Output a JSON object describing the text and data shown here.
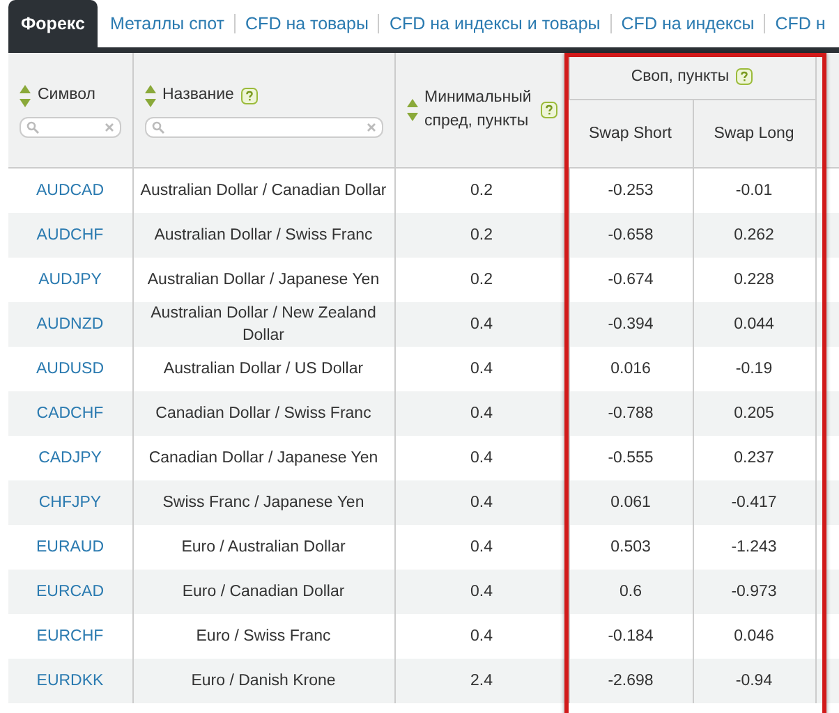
{
  "tabs": [
    {
      "label": "Форекс",
      "selected": true
    },
    {
      "label": "Металлы спот",
      "selected": false
    },
    {
      "label": "CFD на товары",
      "selected": false
    },
    {
      "label": "CFD на индексы и товары",
      "selected": false
    },
    {
      "label": "CFD на индексы",
      "selected": false
    },
    {
      "label": "CFD н",
      "selected": false
    }
  ],
  "table": {
    "columns": [
      {
        "label": "Символ",
        "sortable": true,
        "help": false,
        "search": true
      },
      {
        "label": "Название",
        "sortable": true,
        "help": true,
        "search": true
      },
      {
        "label": "Минимальный спред, пункты",
        "sortable": true,
        "help": true,
        "search": false
      }
    ],
    "swap_group": {
      "label": "Своп, пункты",
      "help": true,
      "highlighted": true,
      "columns": [
        "Swap Short",
        "Swap Long"
      ]
    },
    "rows": [
      {
        "symbol": "AUDCAD",
        "name": "Australian Dollar / Canadian Dollar",
        "spread": "0.2",
        "swap_short": "-0.253",
        "swap_long": "-0.01"
      },
      {
        "symbol": "AUDCHF",
        "name": "Australian Dollar / Swiss Franc",
        "spread": "0.2",
        "swap_short": "-0.658",
        "swap_long": "0.262"
      },
      {
        "symbol": "AUDJPY",
        "name": "Australian Dollar / Japanese Yen",
        "spread": "0.2",
        "swap_short": "-0.674",
        "swap_long": "0.228"
      },
      {
        "symbol": "AUDNZD",
        "name": "Australian Dollar / New Zealand Dollar",
        "spread": "0.4",
        "swap_short": "-0.394",
        "swap_long": "0.044"
      },
      {
        "symbol": "AUDUSD",
        "name": "Australian Dollar / US Dollar",
        "spread": "0.4",
        "swap_short": "0.016",
        "swap_long": "-0.19"
      },
      {
        "symbol": "CADCHF",
        "name": "Canadian Dollar / Swiss Franc",
        "spread": "0.4",
        "swap_short": "-0.788",
        "swap_long": "0.205"
      },
      {
        "symbol": "CADJPY",
        "name": "Canadian Dollar / Japanese Yen",
        "spread": "0.4",
        "swap_short": "-0.555",
        "swap_long": "0.237"
      },
      {
        "symbol": "CHFJPY",
        "name": "Swiss Franc / Japanese Yen",
        "spread": "0.4",
        "swap_short": "0.061",
        "swap_long": "-0.417"
      },
      {
        "symbol": "EURAUD",
        "name": "Euro / Australian Dollar",
        "spread": "0.4",
        "swap_short": "0.503",
        "swap_long": "-1.243"
      },
      {
        "symbol": "EURCAD",
        "name": "Euro / Canadian Dollar",
        "spread": "0.4",
        "swap_short": "0.6",
        "swap_long": "-0.973"
      },
      {
        "symbol": "EURCHF",
        "name": "Euro / Swiss Franc",
        "spread": "0.4",
        "swap_short": "-0.184",
        "swap_long": "0.046"
      },
      {
        "symbol": "EURDKK",
        "name": "Euro / Danish Krone",
        "spread": "2.4",
        "swap_short": "-2.698",
        "swap_long": "-0.94"
      }
    ]
  }
}
